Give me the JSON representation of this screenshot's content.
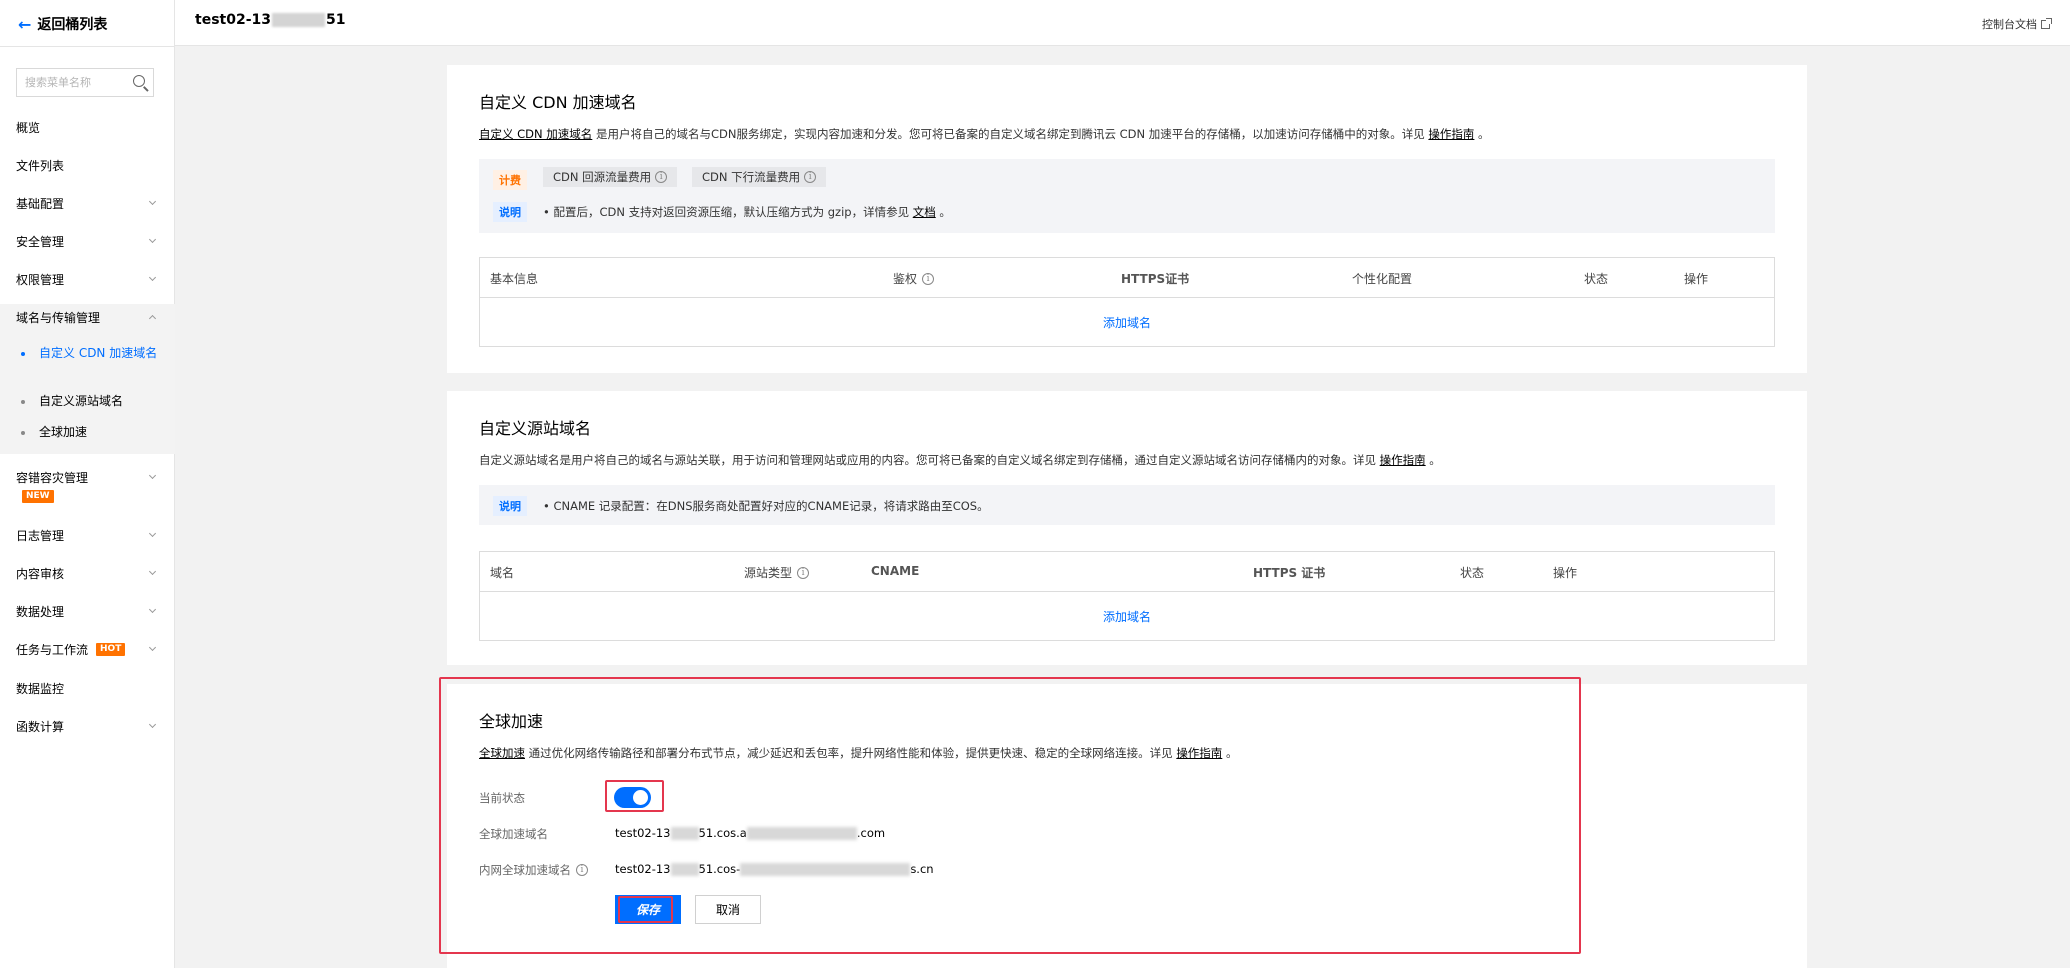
{
  "sidebar": {
    "back_label": "返回桶列表",
    "search_placeholder": "搜索菜单名称",
    "items": {
      "overview": "概览",
      "file_list": "文件列表",
      "basic_config": "基础配置",
      "security": "安全管理",
      "permission": "权限管理",
      "domain_transfer": "域名与传输管理",
      "disaster_recovery": "容错容灾管理",
      "log": "日志管理",
      "content_review": "内容审核",
      "data_processing": "数据处理",
      "tasks_workflow": "任务与工作流",
      "data_monitoring": "数据监控",
      "function_compute": "函数计算"
    },
    "sub_items": {
      "custom_cdn": "自定义 CDN 加速域名",
      "custom_origin": "自定义源站域名",
      "global_accel": "全球加速"
    },
    "badges": {
      "new": "NEW",
      "hot": "HOT"
    }
  },
  "topbar": {
    "bucket_prefix": "test02-13",
    "bucket_suffix": "51",
    "console_doc": "控制台文档"
  },
  "cdn": {
    "title": "自定义 CDN 加速域名",
    "desc_link": "自定义 CDN 加速域名",
    "desc_text": " 是用户将自己的域名与CDN服务绑定，实现内容加速和分发。您可将已备案的自定义域名绑定到腾讯云 CDN 加速平台的存储桶，以加速访问存储桶中的对象。详见 ",
    "desc_guide": "操作指南",
    "desc_end": " 。",
    "fee_tag": "计费",
    "fee_pill_1": "CDN 回源流量费用",
    "fee_pill_2": "CDN 下行流量费用",
    "note_tag": "说明",
    "note_text": "• 配置后，CDN 支持对返回资源压缩，默认压缩方式为 gzip，详情参见 ",
    "note_link": "文档",
    "note_end": " 。",
    "columns": {
      "basic_info": "基本信息",
      "auth": "鉴权",
      "https": "HTTPS证书",
      "custom": "个性化配置",
      "status": "状态",
      "action": "操作"
    },
    "add_domain": "添加域名"
  },
  "origin": {
    "title": "自定义源站域名",
    "desc_text": "自定义源站域名是用户将自己的域名与源站关联，用于访问和管理网站或应用的内容。您可将已备案的自定义域名绑定到存储桶，通过自定义源站域名访问存储桶内的对象。详见 ",
    "desc_guide": "操作指南",
    "desc_end": " 。",
    "note_tag": "说明",
    "note_text": "• CNAME 记录配置：在DNS服务商处配置好对应的CNAME记录，将请求路由至COS。",
    "columns": {
      "domain": "域名",
      "origin_type": "源站类型",
      "cname": "CNAME",
      "https": "HTTPS 证书",
      "status": "状态",
      "action": "操作"
    },
    "add_domain": "添加域名"
  },
  "global": {
    "title": "全球加速",
    "desc_link": "全球加速",
    "desc_text": " 通过优化网络传输路径和部署分布式节点，减少延迟和丢包率，提升网络性能和体验，提供更快速、稳定的全球网络连接。详见 ",
    "desc_guide": "操作指南",
    "desc_end": " 。",
    "status_label": "当前状态",
    "toggle_on": true,
    "domain_label": "全球加速域名",
    "domain_prefix": "test02-13",
    "domain_mid": "51.cos.a",
    "domain_suffix": ".com",
    "intranet_label": "内网全球加速域名",
    "intranet_prefix": "test02-13",
    "intranet_mid": "51.cos-",
    "intranet_suffix": "s.cn",
    "save": "保存",
    "cancel": "取消"
  },
  "colors": {
    "primary": "#006eff",
    "highlight": "#e4364e",
    "fee": "#ff7200"
  }
}
